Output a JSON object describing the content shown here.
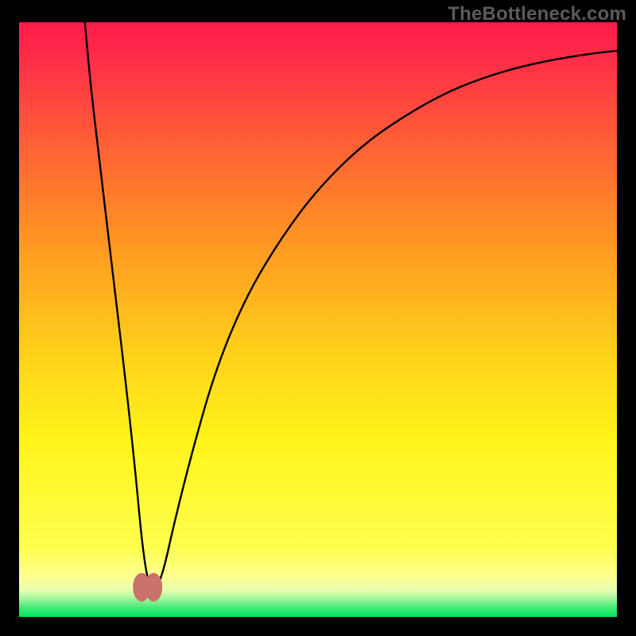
{
  "watermark": "TheBottleneck.com",
  "colors": {
    "frame": "#000000",
    "gradient_top": "#ff1a4a",
    "gradient_mid_high": "#ff7a2a",
    "gradient_mid": "#ffd91a",
    "gradient_low": "#ffff66",
    "gradient_base": "#00e65a",
    "curve": "#000000",
    "marker": "#c9726b"
  },
  "chart_data": {
    "type": "line",
    "title": "",
    "xlabel": "",
    "ylabel": "",
    "xlim": [
      0,
      100
    ],
    "ylim": [
      0,
      100
    ],
    "series": [
      {
        "name": "bottleneck-curve",
        "x": [
          11,
          12,
          14,
          16,
          18,
          19.5,
          20.5,
          21.5,
          22.5,
          24,
          26,
          29,
          33,
          38,
          44,
          50,
          57,
          64,
          72,
          80,
          88,
          96,
          100
        ],
        "y": [
          100,
          89,
          72,
          55,
          38,
          24,
          13,
          6,
          4,
          7,
          16,
          28,
          42,
          54,
          64,
          72,
          79,
          84,
          88.5,
          91.5,
          93.5,
          94.8,
          95.2
        ]
      }
    ],
    "markers": [
      {
        "name": "minimum-left",
        "x": 20.5,
        "y": 5
      },
      {
        "name": "minimum-right",
        "x": 22.5,
        "y": 5
      }
    ],
    "gradient_bands": [
      {
        "y_from": 100,
        "y_to": 62,
        "color": "red-orange"
      },
      {
        "y_from": 62,
        "y_to": 30,
        "color": "orange-yellow"
      },
      {
        "y_from": 30,
        "y_to": 7,
        "color": "yellow"
      },
      {
        "y_from": 7,
        "y_to": 3,
        "color": "pale-yellow"
      },
      {
        "y_from": 3,
        "y_to": 0,
        "color": "green"
      }
    ]
  }
}
